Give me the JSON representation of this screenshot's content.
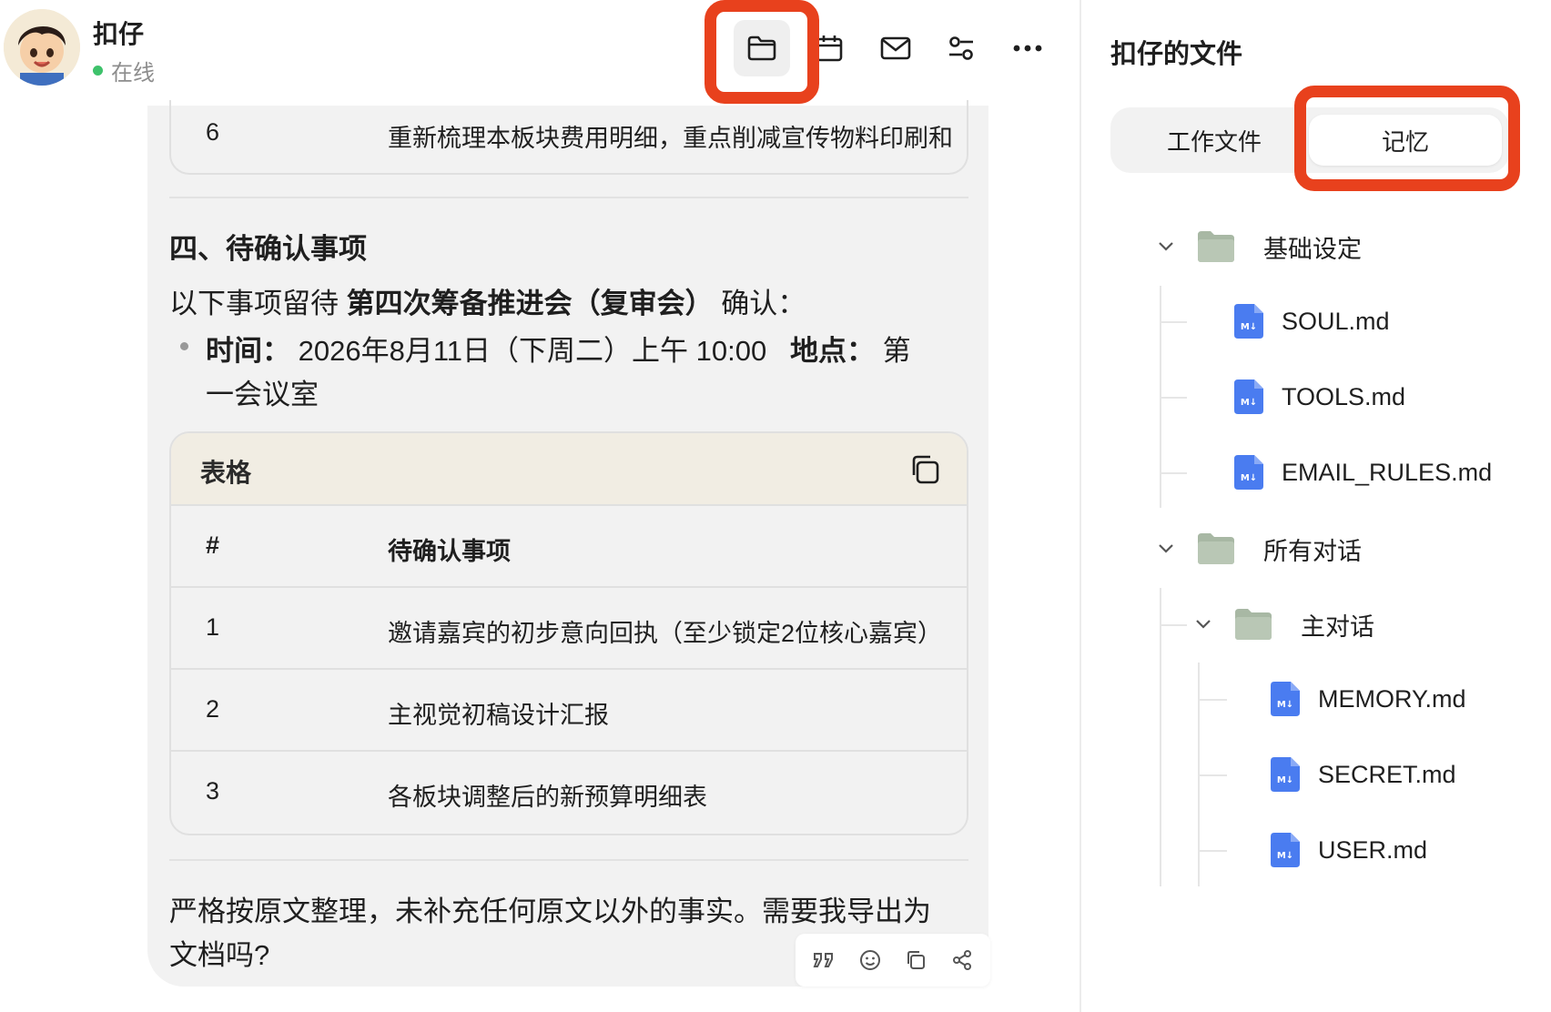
{
  "header": {
    "contact_name": "扣仔",
    "status": "在线"
  },
  "toolbar": {
    "items": [
      {
        "icon": "folder-icon",
        "active": true
      },
      {
        "icon": "calendar-icon"
      },
      {
        "icon": "mail-icon"
      },
      {
        "icon": "settings-sliders-icon"
      },
      {
        "icon": "more-icon"
      }
    ]
  },
  "chat": {
    "prev_table_row": {
      "num": "6",
      "text": "重新梳理本板块费用明细，重点削减宣传物料印刷和"
    },
    "section_title": "四、待确认事项",
    "intro_before": "以下事项留待",
    "intro_bold": "第四次筹备推进会（复审会）",
    "intro_after": "确认：",
    "bullet_time_label": "时间：",
    "bullet_time_value": "2026年8月11日（下周二）上午 10:00",
    "bullet_place_label": "地点：",
    "bullet_place_value_1": "第",
    "bullet_place_value_2": "一会议室",
    "table": {
      "title": "表格",
      "columns": [
        "#",
        "待确认事项"
      ],
      "rows": [
        {
          "num": "1",
          "text": "邀请嘉宾的初步意向回执（至少锁定2位核心嘉宾）"
        },
        {
          "num": "2",
          "text": "主视觉初稿设计汇报"
        },
        {
          "num": "3",
          "text": "各板块调整后的新预算明细表"
        }
      ]
    },
    "closing_line_1": "严格按原文整理，未补充任何原文以外的事实。需要我导出为",
    "closing_line_2": "文档吗?",
    "actions": [
      "quote-icon",
      "emoji-icon",
      "copy-icon",
      "share-icon"
    ]
  },
  "panel": {
    "title": "扣仔的文件",
    "tabs": [
      {
        "label": "工作文件",
        "active": false
      },
      {
        "label": "记忆",
        "active": true
      }
    ],
    "tree": {
      "folder_basic": "基础设定",
      "basic_files": [
        "SOUL.md",
        "TOOLS.md",
        "EMAIL_RULES.md"
      ],
      "folder_all": "所有对话",
      "folder_main": "主对话",
      "main_files": [
        "MEMORY.md",
        "SECRET.md",
        "USER.md"
      ]
    }
  },
  "colors": {
    "highlight": "#e8411d",
    "online": "#3ec26b",
    "md_icon": "#4a7cf0",
    "folder": "#a8b8a4"
  }
}
